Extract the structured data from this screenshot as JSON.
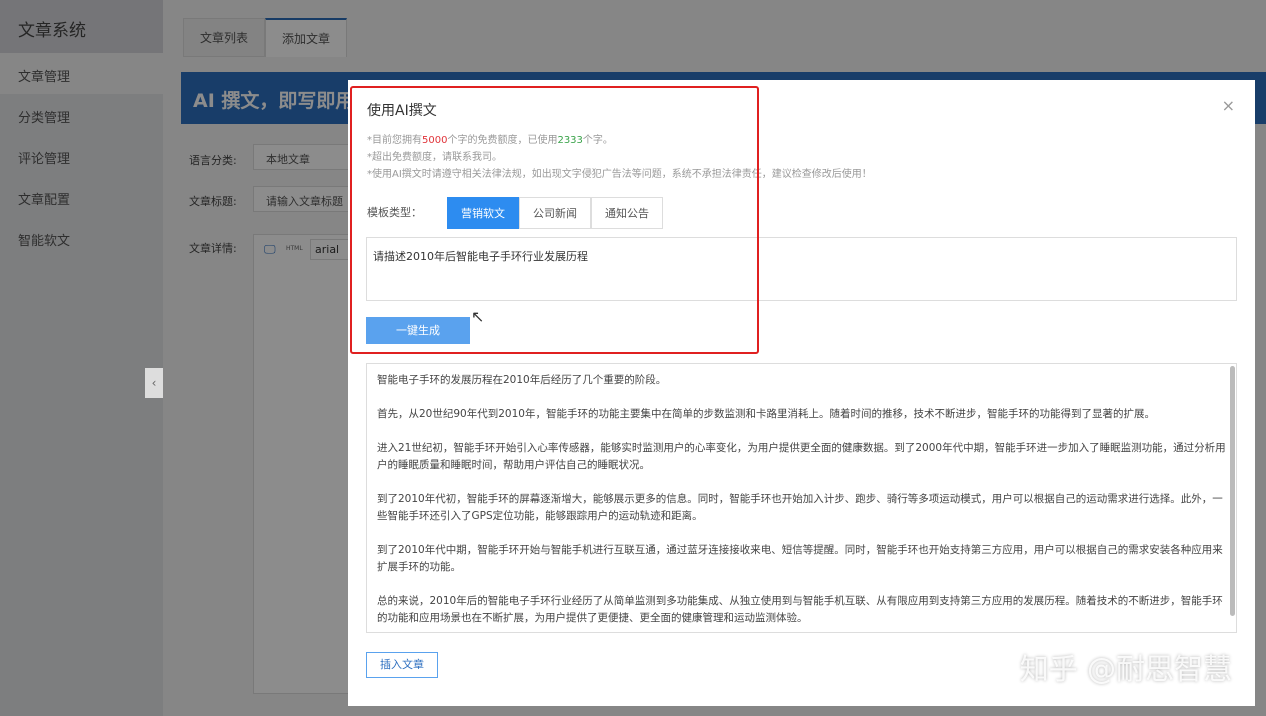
{
  "sidebar": {
    "title": "文章系统",
    "items": [
      {
        "label": "文章管理"
      },
      {
        "label": "分类管理"
      },
      {
        "label": "评论管理"
      },
      {
        "label": "文章配置"
      },
      {
        "label": "智能软文"
      }
    ]
  },
  "tabs": [
    {
      "label": "文章列表"
    },
    {
      "label": "添加文章"
    }
  ],
  "banner": {
    "text": "AI 撰文，即写即用，"
  },
  "form": {
    "lang_label": "语言分类:",
    "lang_value": "本地文章",
    "title_label": "文章标题:",
    "title_placeholder": "请输入文章标题",
    "detail_label": "文章详情:",
    "font_value": "arial",
    "html_label": "HTML"
  },
  "modal": {
    "title": "使用AI撰文",
    "close": "×",
    "note1_pre": "*目前您拥有",
    "quota": "5000",
    "note1_mid": "个字的免费额度，已使用",
    "used": "2333",
    "note1_post": "个字。",
    "note2": "*超出免费额度，请联系我司。",
    "note3": "*使用AI撰文时请遵守相关法律法规，如出现文字侵犯广告法等问题，系统不承担法律责任，建议检查修改后使用！",
    "template_label": "模板类型：",
    "templates": [
      {
        "label": "营销软文"
      },
      {
        "label": "公司新闻"
      },
      {
        "label": "通知公告"
      }
    ],
    "prompt_value": "请描述2010年后智能电子手环行业发展历程",
    "generate_label": "一键生成",
    "result": [
      "智能电子手环的发展历程在2010年后经历了几个重要的阶段。",
      "首先，从20世纪90年代到2010年，智能手环的功能主要集中在简单的步数监测和卡路里消耗上。随着时间的推移，技术不断进步，智能手环的功能得到了显著的扩展。",
      "进入21世纪初，智能手环开始引入心率传感器，能够实时监测用户的心率变化，为用户提供更全面的健康数据。到了2000年代中期，智能手环进一步加入了睡眠监测功能，通过分析用户的睡眠质量和睡眠时间，帮助用户评估自己的睡眠状况。",
      "到了2010年代初，智能手环的屏幕逐渐增大，能够展示更多的信息。同时，智能手环也开始加入计步、跑步、骑行等多项运动模式，用户可以根据自己的运动需求进行选择。此外，一些智能手环还引入了GPS定位功能，能够跟踪用户的运动轨迹和距离。",
      "到了2010年代中期，智能手环开始与智能手机进行互联互通，通过蓝牙连接接收来电、短信等提醒。同时，智能手环也开始支持第三方应用，用户可以根据自己的需求安装各种应用来扩展手环的功能。",
      "总的来说，2010年后的智能电子手环行业经历了从简单监测到多功能集成、从独立使用到与智能手机互联、从有限应用到支持第三方应用的发展历程。随着技术的不断进步，智能手环的功能和应用场景也在不断扩展，为用户提供了更便捷、更全面的健康管理和运动监测体验。"
    ],
    "insert_label": "插入文章"
  },
  "watermark": "知乎 @耐思智慧",
  "colors": {
    "accent": "#2d8cf0",
    "highlight_box": "#e02020",
    "quota": "#e0343a",
    "used": "#3aa34a"
  }
}
